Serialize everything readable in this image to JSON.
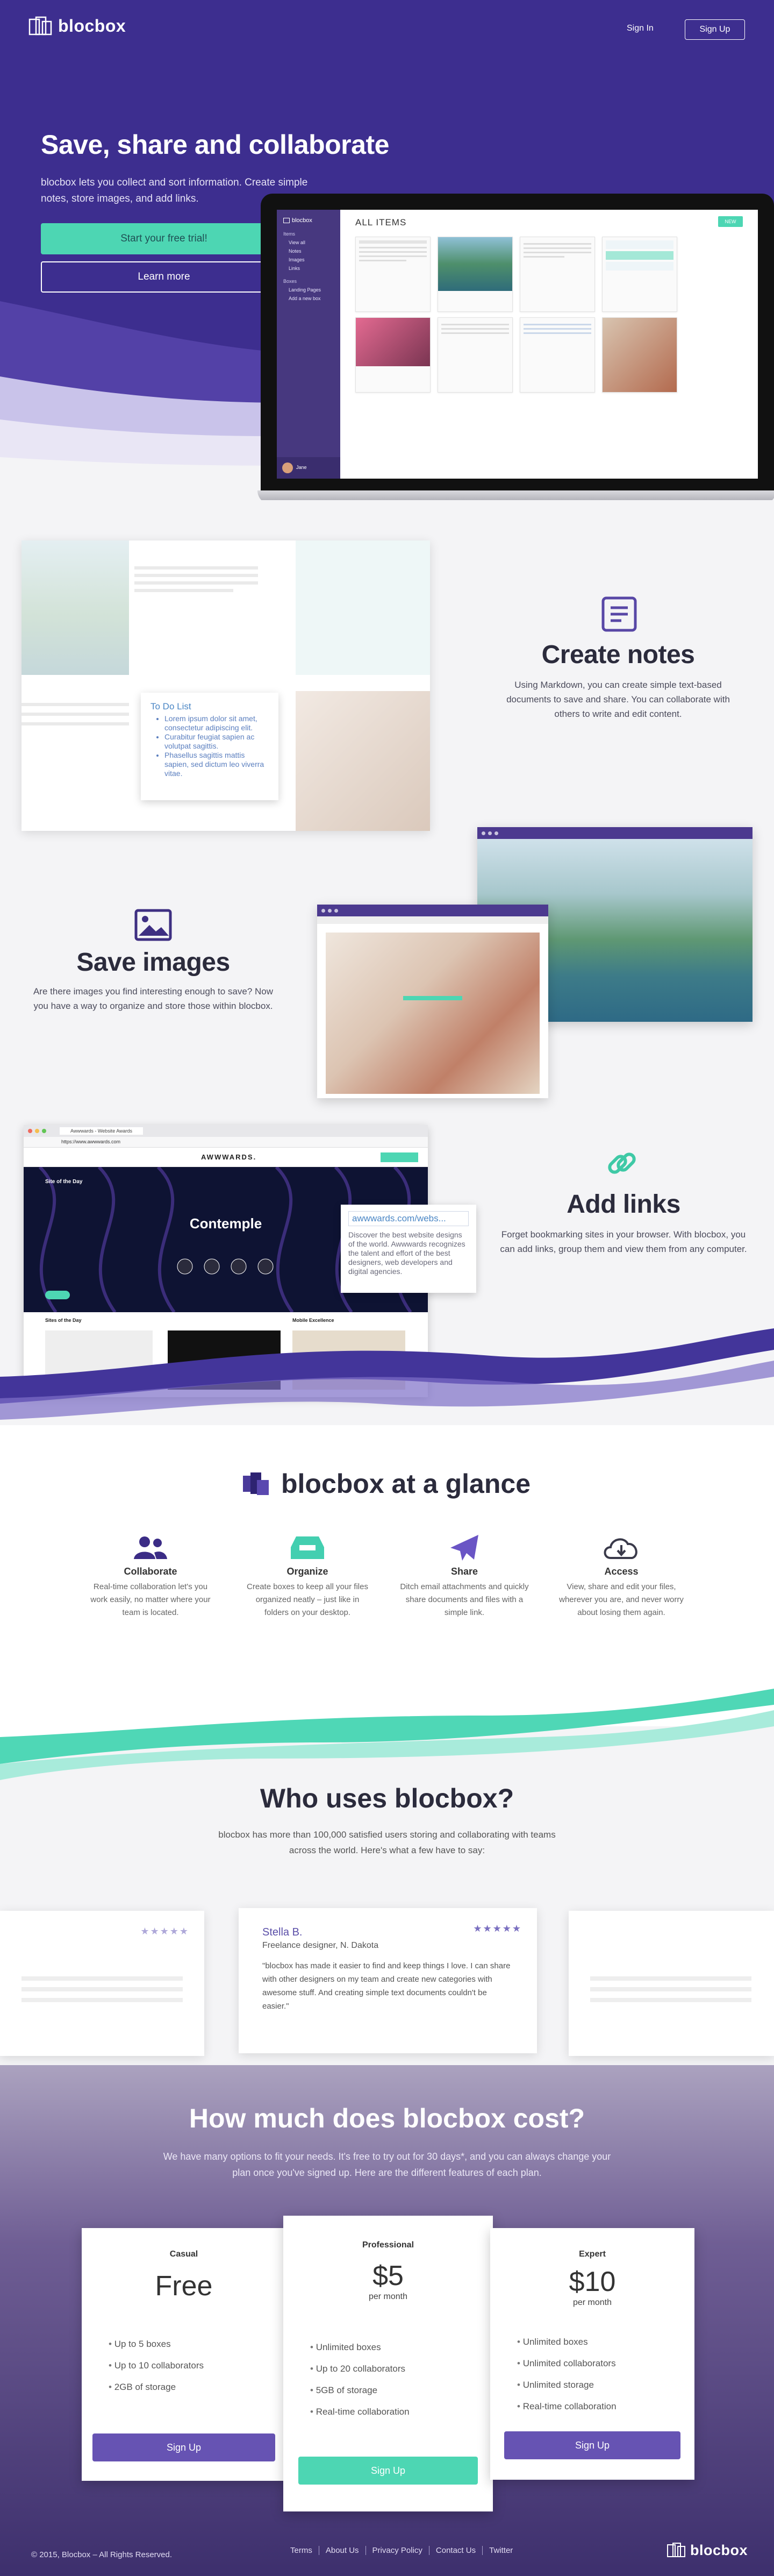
{
  "nav": {
    "logo": "blocbox",
    "signin": "Sign In",
    "signup": "Sign Up"
  },
  "hero": {
    "title": "Save, share and collaborate",
    "subtitle": "blocbox lets you collect and sort information. Create simple notes, store images, and add links.",
    "cta_primary": "Start your free trial!",
    "cta_secondary": "Learn more"
  },
  "app_preview": {
    "logo": "blocbox",
    "title": "ALL ITEMS",
    "new_button": "NEW",
    "sidebar_header_items": "Items",
    "sidebar_items": [
      "View all",
      "Notes",
      "Images",
      "Links"
    ],
    "sidebar_header_boxes": "Boxes",
    "sidebar_boxes": [
      "Landing Pages",
      "Add a new box"
    ],
    "user": "Jane"
  },
  "features": {
    "notes": {
      "title": "Create notes",
      "text": "Using Markdown, you can create simple text-based documents to save and share. You can collaborate with others to write and edit content.",
      "todo_title": "To Do List",
      "todo_items": [
        "Lorem ipsum dolor sit amet, consectetur adipiscing elit.",
        "Curabitur feugiat sapien ac volutpat sagittis.",
        "Phasellus sagittis mattis sapien, sed dictum leo viverra vitae."
      ]
    },
    "images": {
      "title": "Save images",
      "text": "Are there images you find interesting enough to save? Now you have a way to organize and store those within blocbox."
    },
    "links": {
      "title": "Add links",
      "text": "Forget bookmarking sites in your browser. With blocbox, you can add links, group them and view them from any computer.",
      "tip_url": "awwwards.com/webs...",
      "tip_text": "Discover the best website designs of the world. Awwwards recognizes the talent and effort of the best designers, web developers and digital agencies.",
      "browser_site": "AWWWARDS.",
      "browser_heading": "Contemple",
      "browser_tab": "Awwwards - Website Awards",
      "browser_url": "https://www.awwwards.com",
      "browser_sotd": "Site of the Day",
      "browser_nominees": "Sites of the Day",
      "browser_mobile": "Mobile Excellence"
    }
  },
  "glance": {
    "title": "blocbox at a glance",
    "items": [
      {
        "icon": "users-icon",
        "name": "Collaborate",
        "text": "Real-time collaboration let's you work easily, no matter where your team is located."
      },
      {
        "icon": "inbox-icon",
        "name": "Organize",
        "text": "Create boxes to keep all your files organized neatly – just like in folders on your desktop."
      },
      {
        "icon": "paper-plane-icon",
        "name": "Share",
        "text": "Ditch email attachments and quickly share documents and files with a simple link."
      },
      {
        "icon": "cloud-download-icon",
        "name": "Access",
        "text": "View, share and edit your files, wherever you are, and never worry about losing them again."
      }
    ]
  },
  "who": {
    "title": "Who uses blocbox?",
    "text": "blocbox has more than 100,000 satisfied users storing and collaborating with teams across the world. Here's what a few have to say:",
    "testimonial": {
      "name": "Stella B.",
      "role": "Freelance designer, N. Dakota",
      "stars": "★★★★★",
      "quote": "\"blocbox has made it easier to find and keep things I love. I can share with other designers on my team and create new categories with awesome stuff. And creating simple text documents couldn't be easier.\""
    },
    "side_stars": "★★★★★"
  },
  "pricing": {
    "title": "How much does blocbox cost?",
    "text": "We have many options to fit your needs. It's free to try out for 30 days*, and you can always change your plan once you've signed up. Here are the different features of each plan.",
    "plans": [
      {
        "name": "Casual",
        "price": "Free",
        "per": "",
        "features": [
          "Up to 5 boxes",
          "Up to 10 collaborators",
          "2GB of storage"
        ],
        "button": "Sign Up"
      },
      {
        "name": "Professional",
        "price": "$5",
        "per": "per month",
        "features": [
          "Unlimited boxes",
          "Up to 20 collaborators",
          "5GB of storage",
          "Real-time collaboration"
        ],
        "button": "Sign Up"
      },
      {
        "name": "Expert",
        "price": "$10",
        "per": "per month",
        "features": [
          "Unlimited boxes",
          "Unlimited collaborators",
          "Unlimited storage",
          "Real-time collaboration"
        ],
        "button": "Sign Up"
      }
    ]
  },
  "footer": {
    "copyright": "© 2015, Blocbox – All Rights Reserved.",
    "links": [
      "Terms",
      "About Us",
      "Privacy Policy",
      "Contact Us",
      "Twitter"
    ],
    "logo": "blocbox"
  },
  "colors": {
    "brand_purple": "#3d2e8f",
    "accent_teal": "#4dd6b3",
    "button_purple": "#6653b3"
  }
}
